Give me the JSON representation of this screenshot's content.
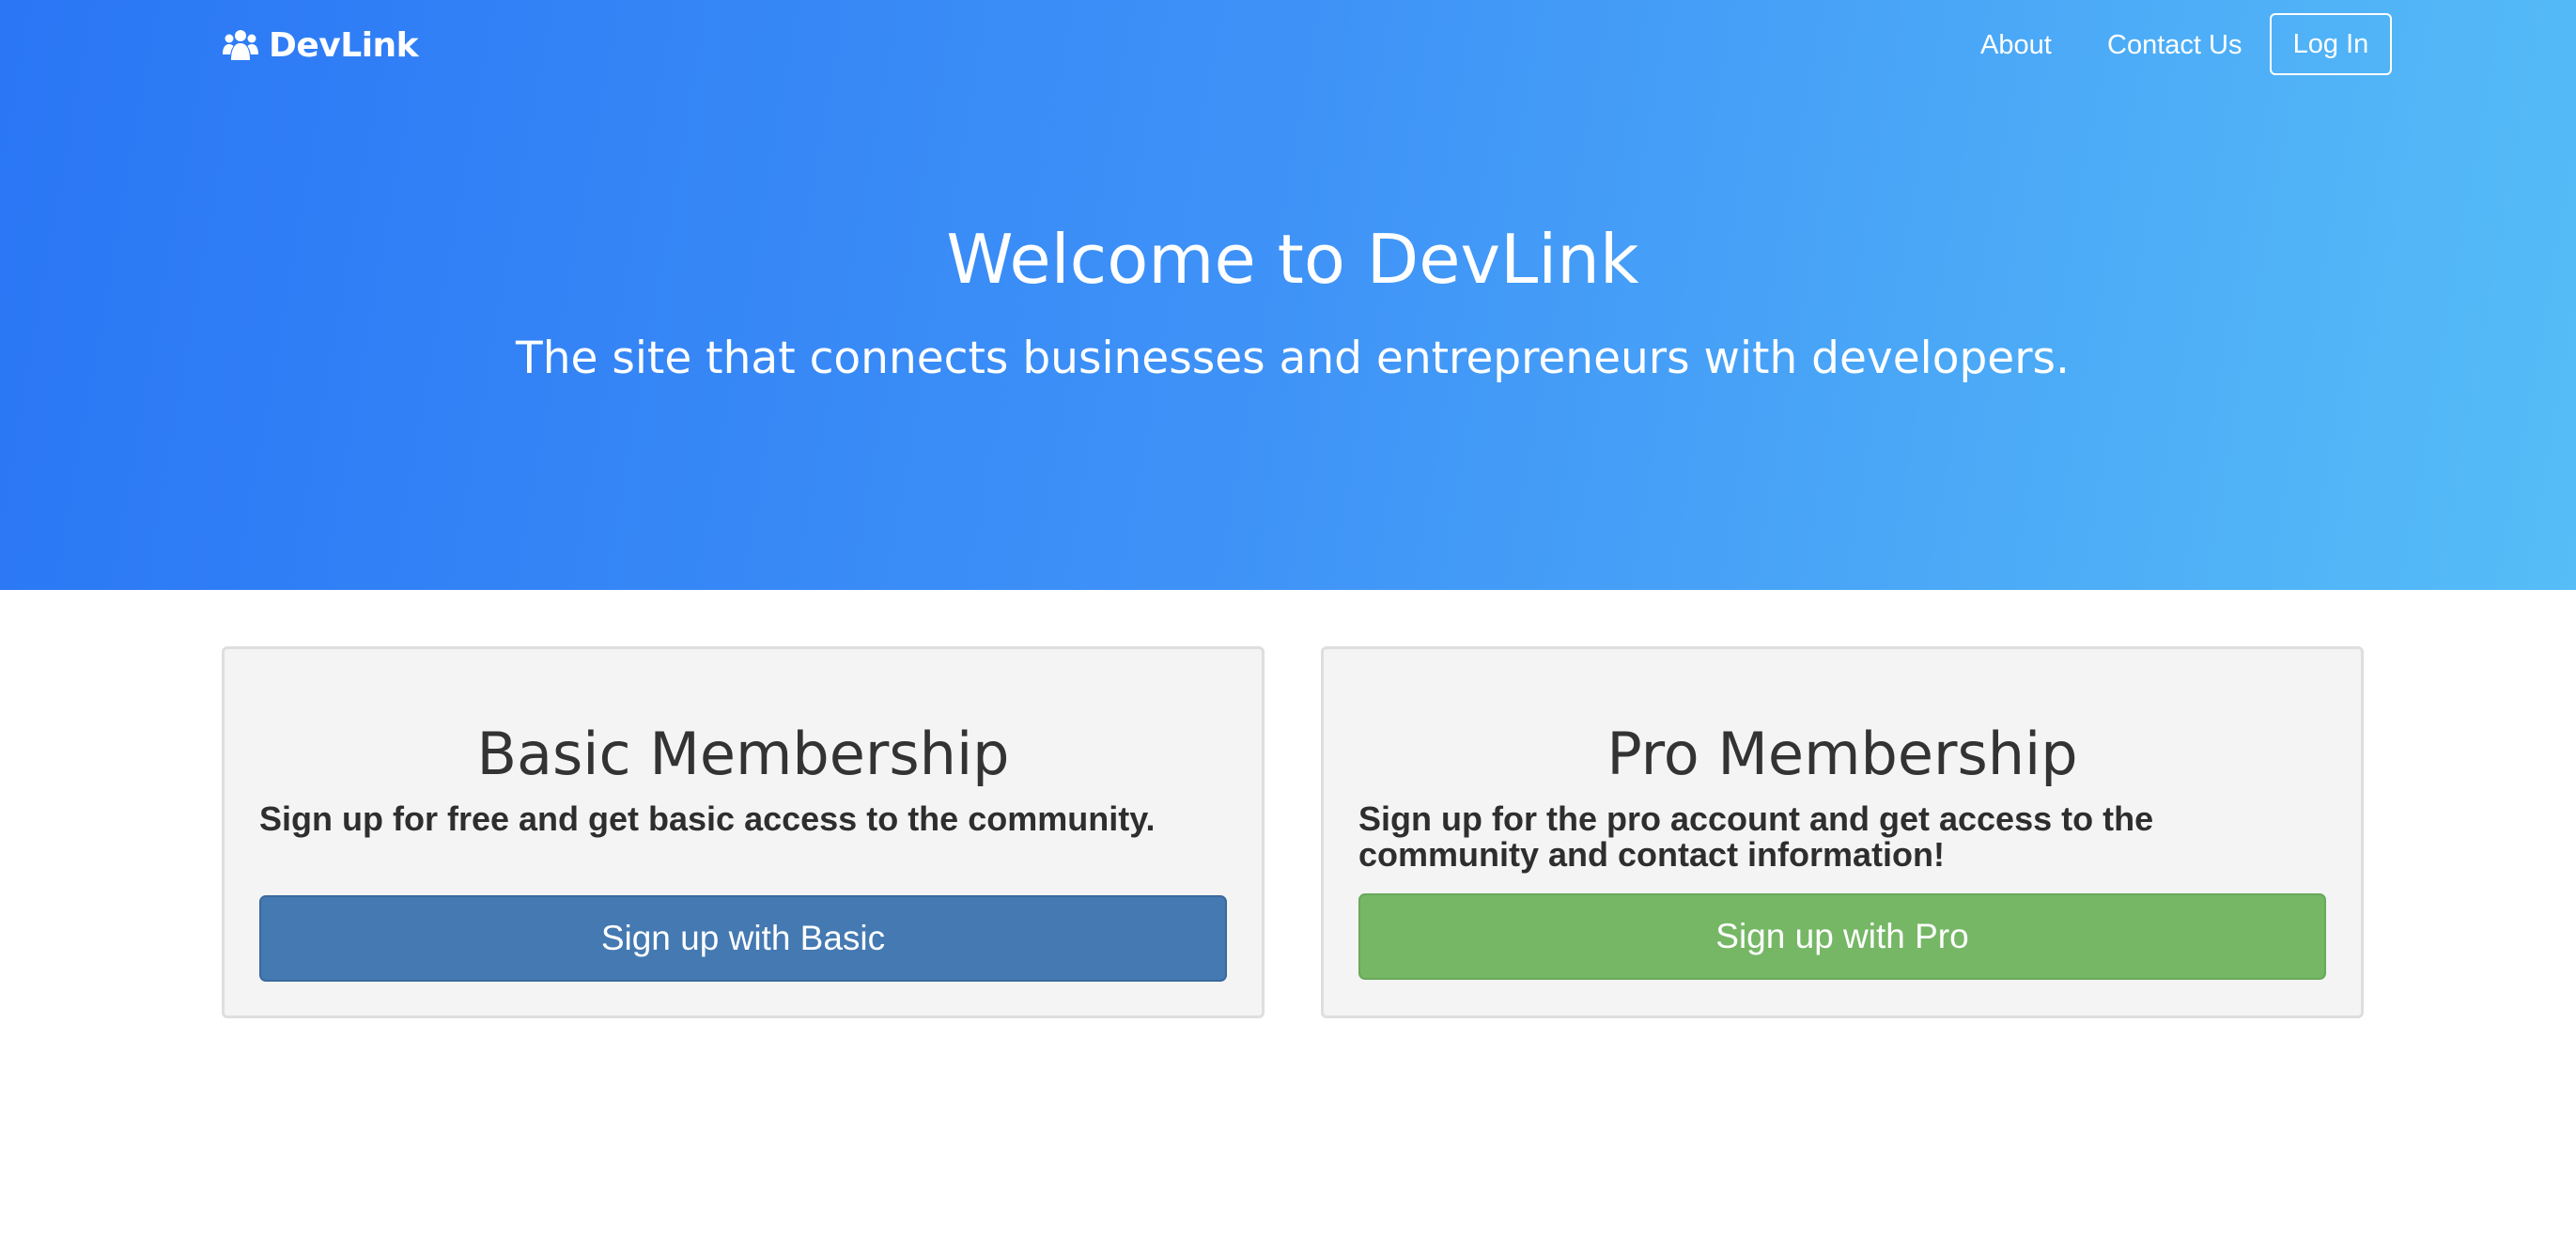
{
  "nav": {
    "brand": "DevLink",
    "brand_icon": "users-icon",
    "links": [
      "About",
      "Contact Us"
    ],
    "login_label": "Log In"
  },
  "hero": {
    "title": "Welcome to DevLink",
    "subtitle": "The site that connects businesses and entrepreneurs with developers."
  },
  "cards": [
    {
      "title": "Basic Membership",
      "text": "Sign up for free and get basic access to the community.",
      "button_label": "Sign up with Basic",
      "button_color": "#4479b2"
    },
    {
      "title": "Pro Membership",
      "text": "Sign up for the pro account and get access to the community and contact information!",
      "button_label": "Sign up with Pro",
      "button_color": "#76b766"
    }
  ],
  "colors": {
    "hero_gradient_start": "#2a76f5",
    "hero_gradient_end": "#56bdf7",
    "card_background": "#f4f4f4"
  }
}
